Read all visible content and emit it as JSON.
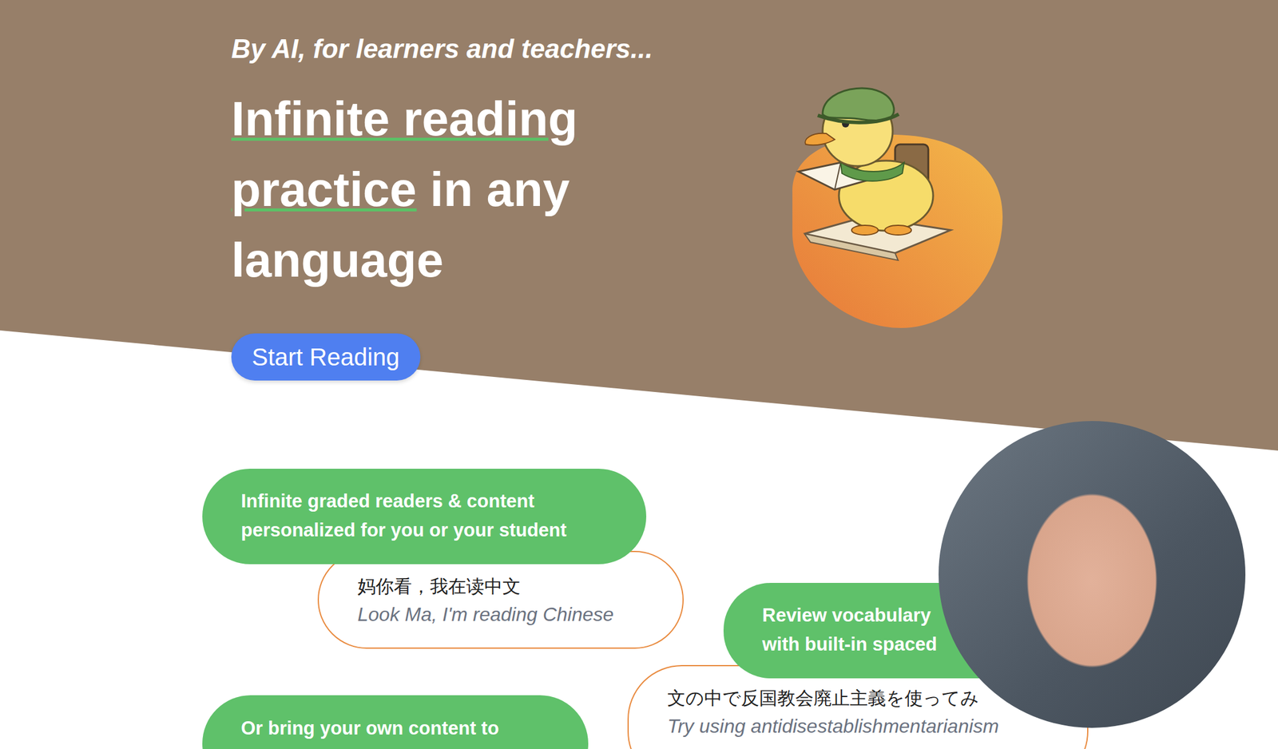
{
  "hero": {
    "tagline": "By AI, for learners and teachers...",
    "headline_highlight": "Infinite reading practice",
    "headline_rest": " in any language",
    "cta": "Start Reading"
  },
  "features": [
    {
      "kind": "feature",
      "lines": [
        "Infinite graded readers & content",
        "personalized for you or your student"
      ]
    },
    {
      "kind": "example",
      "text": "妈你看，我在读中文",
      "translation": "Look Ma, I'm reading Chinese"
    },
    {
      "kind": "feature",
      "lines": [
        "Review vocabulary",
        "with built-in spaced"
      ]
    },
    {
      "kind": "example",
      "text": "文の中で反国教会廃止主義を使ってみ",
      "translation": "Try using antidisestablishmentarianism"
    },
    {
      "kind": "feature",
      "lines": [
        "Or bring your own content to"
      ]
    }
  ]
}
